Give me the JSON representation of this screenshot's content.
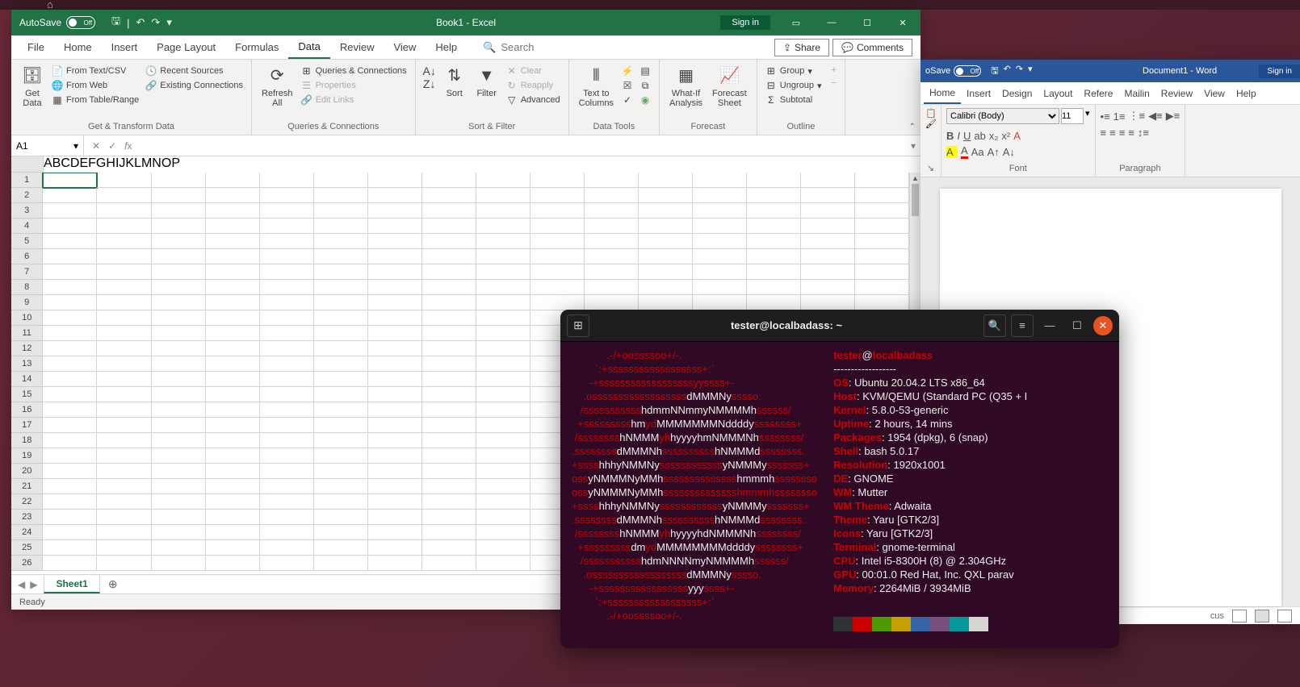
{
  "ubuntu": {
    "home": "⌂"
  },
  "excel": {
    "autosave_label": "AutoSave",
    "autosave_state": "Off",
    "title": "Book1 - Excel",
    "signin": "Sign in",
    "tabs": [
      "File",
      "Home",
      "Insert",
      "Page Layout",
      "Formulas",
      "Data",
      "Review",
      "View",
      "Help"
    ],
    "active_tab": "Data",
    "search_placeholder": "Search",
    "share": "Share",
    "comments": "Comments",
    "ribbon": {
      "get_data": "Get\nData",
      "from_textcsv": "From Text/CSV",
      "from_web": "From Web",
      "from_table": "From Table/Range",
      "recent_sources": "Recent Sources",
      "existing_conn": "Existing Connections",
      "group_get": "Get & Transform Data",
      "refresh": "Refresh\nAll",
      "queries_conn": "Queries & Connections",
      "properties": "Properties",
      "edit_links": "Edit Links",
      "group_qc": "Queries & Connections",
      "sort": "Sort",
      "filter": "Filter",
      "clear": "Clear",
      "reapply": "Reapply",
      "advanced": "Advanced",
      "group_sf": "Sort & Filter",
      "text_to_col": "Text to\nColumns",
      "group_dt": "Data Tools",
      "whatif": "What-If\nAnalysis",
      "forecast_sheet": "Forecast\nSheet",
      "group_fc": "Forecast",
      "group": "Group",
      "ungroup": "Ungroup",
      "subtotal": "Subtotal",
      "group_ol": "Outline"
    },
    "cellref": "A1",
    "columns": [
      "A",
      "B",
      "C",
      "D",
      "E",
      "F",
      "G",
      "H",
      "I",
      "J",
      "K",
      "L",
      "M",
      "N",
      "O",
      "P"
    ],
    "rows": 26,
    "sheet_name": "Sheet1",
    "status": "Ready"
  },
  "word": {
    "autosave_label": "oSave",
    "autosave_state": "Off",
    "title": "Document1 - Word",
    "signin": "Sign in",
    "tabs": [
      "Home",
      "Insert",
      "Design",
      "Layout",
      "Refere",
      "Mailin",
      "Review",
      "View",
      "Help"
    ],
    "active_tab": "Home",
    "font_name": "Calibri (Body)",
    "font_size": "11",
    "group_font": "Font",
    "group_para": "Paragraph",
    "focus": "cus"
  },
  "terminal": {
    "title": "tester@localbadass: ~",
    "user": "tester",
    "host": "localbadass",
    "info": [
      {
        "k": "OS",
        "v": "Ubuntu 20.04.2 LTS x86_64"
      },
      {
        "k": "Host",
        "v": "KVM/QEMU (Standard PC (Q35 + I"
      },
      {
        "k": "Kernel",
        "v": "5.8.0-53-generic"
      },
      {
        "k": "Uptime",
        "v": "2 hours, 14 mins"
      },
      {
        "k": "Packages",
        "v": "1954 (dpkg), 6 (snap)"
      },
      {
        "k": "Shell",
        "v": "bash 5.0.17"
      },
      {
        "k": "Resolution",
        "v": "1920x1001"
      },
      {
        "k": "DE",
        "v": "GNOME"
      },
      {
        "k": "WM",
        "v": "Mutter"
      },
      {
        "k": "WM Theme",
        "v": "Adwaita"
      },
      {
        "k": "Theme",
        "v": "Yaru [GTK2/3]"
      },
      {
        "k": "Icons",
        "v": "Yaru [GTK2/3]"
      },
      {
        "k": "Terminal",
        "v": "gnome-terminal"
      },
      {
        "k": "CPU",
        "v": "Intel i5-8300H (8) @ 2.304GHz"
      },
      {
        "k": "GPU",
        "v": "00:01.0 Red Hat, Inc. QXL parav"
      },
      {
        "k": "Memory",
        "v": "2264MiB / 3934MiB"
      }
    ],
    "palette": [
      "#2e3436",
      "#cc0000",
      "#4e9a06",
      "#c4a000",
      "#3465a4",
      "#75507b",
      "#06989a",
      "#d3d7cf"
    ],
    "art": [
      [
        {
          "r": "            .-/+oossssoo+/-."
        }
      ],
      [
        {
          "r": "        `:+ssssssssssssssssss+:`"
        }
      ],
      [
        {
          "r": "      -+ssssssssssssssssssyyssss+-"
        }
      ],
      [
        {
          "r": "    .ossssssssssssssssss"
        },
        {
          "w": "dMMMNy"
        },
        {
          "r": "sssso."
        }
      ],
      [
        {
          "r": "   /sssssssssss"
        },
        {
          "w": "hdmmNNmmyNMMMMh"
        },
        {
          "r": "ssssss/"
        }
      ],
      [
        {
          "r": "  +sssssssss"
        },
        {
          "w": "hm"
        },
        {
          "r": "yd"
        },
        {
          "w": "MMMMMMMNddddy"
        },
        {
          "r": "ssssssss+"
        }
      ],
      [
        {
          "r": " /ssssssss"
        },
        {
          "w": "hNMMM"
        },
        {
          "r": "yh"
        },
        {
          "w": "hyyyyhmNMMMNh"
        },
        {
          "r": "ssssssss/"
        }
      ],
      [
        {
          "r": ".ssssssss"
        },
        {
          "w": "dMMMNh"
        },
        {
          "r": "ssssssssss"
        },
        {
          "w": "hNMMMd"
        },
        {
          "r": "ssssssss."
        }
      ],
      [
        {
          "r": "+ssss"
        },
        {
          "w": "hhhyNMMNy"
        },
        {
          "r": "ssssssssssss"
        },
        {
          "w": "yNMMMy"
        },
        {
          "r": "sssssss+"
        }
      ],
      [
        {
          "r": "oss"
        },
        {
          "w": "yNMMMNyMMh"
        },
        {
          "r": "ssssssssssssss"
        },
        {
          "w": "hmmmh"
        },
        {
          "r": "ssssssso"
        }
      ],
      [
        {
          "r": "oss"
        },
        {
          "w": "yNMMMNyMMh"
        },
        {
          "r": "sssssssssssssshmmmhssssssso"
        }
      ],
      [
        {
          "r": "+ssss"
        },
        {
          "w": "hhhyNMMNy"
        },
        {
          "r": "ssssssssssss"
        },
        {
          "w": "yNMMMy"
        },
        {
          "r": "sssssss+"
        }
      ],
      [
        {
          "r": ".ssssssss"
        },
        {
          "w": "dMMMNh"
        },
        {
          "r": "ssssssssss"
        },
        {
          "w": "hNMMMd"
        },
        {
          "r": "ssssssss."
        }
      ],
      [
        {
          "r": " /ssssssss"
        },
        {
          "w": "hNMMM"
        },
        {
          "r": "yh"
        },
        {
          "w": "hyyyyhdNMMMNh"
        },
        {
          "r": "ssssssss/"
        }
      ],
      [
        {
          "r": "  +sssssssss"
        },
        {
          "w": "dm"
        },
        {
          "r": "yd"
        },
        {
          "w": "MMMMMMMMddddy"
        },
        {
          "r": "ssssssss+"
        }
      ],
      [
        {
          "r": "   /sssssssssss"
        },
        {
          "w": "hdmNNNNmyNMMMMh"
        },
        {
          "r": "ssssss/"
        }
      ],
      [
        {
          "r": "    .ossssssssssssssssss"
        },
        {
          "w": "dMMMNy"
        },
        {
          "r": "sssso."
        }
      ],
      [
        {
          "r": "      -+sssssssssssssssss"
        },
        {
          "w": "yyy"
        },
        {
          "r": "ssss+-"
        }
      ],
      [
        {
          "r": "        `:+ssssssssssssssssss+:`"
        }
      ],
      [
        {
          "r": "            .-/+oossssoo+/-."
        }
      ]
    ]
  }
}
